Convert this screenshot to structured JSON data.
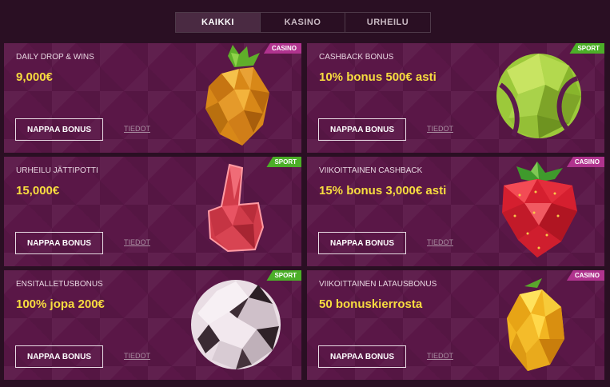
{
  "tabs": [
    {
      "label": "KAIKKI",
      "active": true
    },
    {
      "label": "KASINO",
      "active": false
    },
    {
      "label": "URHEILU",
      "active": false
    }
  ],
  "cards": [
    {
      "title": "DAILY DROP & WINS",
      "value": "9,000€",
      "button": "NAPPAA BONUS",
      "details": "TIEDOT",
      "badge": "CASINO",
      "icon": "pineapple-icon"
    },
    {
      "title": "CASHBACK BONUS",
      "value": "10% bonus 500€ asti",
      "button": "NAPPAA BONUS",
      "details": "TIEDOT",
      "badge": "SPORT",
      "icon": "tennis-ball-icon"
    },
    {
      "title": "URHEILU JÄTTIPOTTI",
      "value": "15,000€",
      "button": "NAPPAA BONUS",
      "details": "TIEDOT",
      "badge": "SPORT",
      "icon": "foam-finger-icon"
    },
    {
      "title": "VIIKOITTAINEN CASHBACK",
      "value": "15% bonus 3,000€ asti",
      "button": "NAPPAA BONUS",
      "details": "TIEDOT",
      "badge": "CASINO",
      "icon": "strawberry-icon"
    },
    {
      "title": "ENSITALLETUSBONUS",
      "value": "100% jopa 200€",
      "button": "NAPPAA BONUS",
      "details": "TIEDOT",
      "badge": "SPORT",
      "icon": "soccer-ball-icon"
    },
    {
      "title": "VIIKOITTAINEN LATAUSBONUS",
      "value": "50 bonuskierrosta",
      "button": "NAPPAA BONUS",
      "details": "TIEDOT",
      "badge": "CASINO",
      "icon": "lemon-icon"
    }
  ],
  "colors": {
    "background": "#2a0f23",
    "card": "#5a1747",
    "value_yellow": "#f7dc3f",
    "casino_badge": "#b0338e",
    "sport_badge": "#4caf28"
  }
}
